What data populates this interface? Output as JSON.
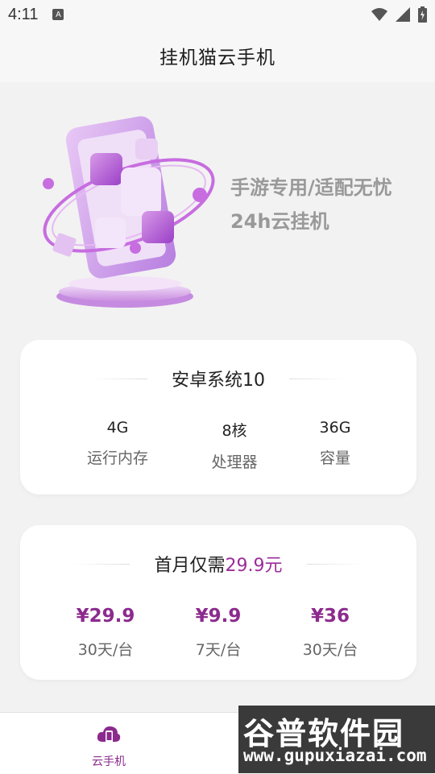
{
  "status_bar": {
    "time": "4:11",
    "notification_glyph": "A"
  },
  "header": {
    "title": "挂机猫云手机"
  },
  "hero": {
    "line1": "手游专用/适配无忧",
    "line2": "24h云挂机"
  },
  "spec_card": {
    "title": "安卓系统10",
    "items": [
      {
        "value": "4G",
        "label": "运行内存"
      },
      {
        "value": "8核",
        "label": "处理器"
      },
      {
        "value": "36G",
        "label": "容量"
      }
    ]
  },
  "price_card": {
    "title_prefix": "首月仅需",
    "title_price": "29.9元",
    "items": [
      {
        "price": "¥29.9",
        "label": "30天/台"
      },
      {
        "price": "¥9.9",
        "label": "7天/台"
      },
      {
        "price": "¥36",
        "label": "30天/台"
      }
    ]
  },
  "tabbar": {
    "tab_label": "云手机"
  },
  "watermark": {
    "title": "谷普软件园",
    "url": "www.gupuxiazai.com"
  },
  "colors": {
    "accent": "#8c2b8e",
    "background": "#f2f2f2",
    "card": "#ffffff"
  }
}
